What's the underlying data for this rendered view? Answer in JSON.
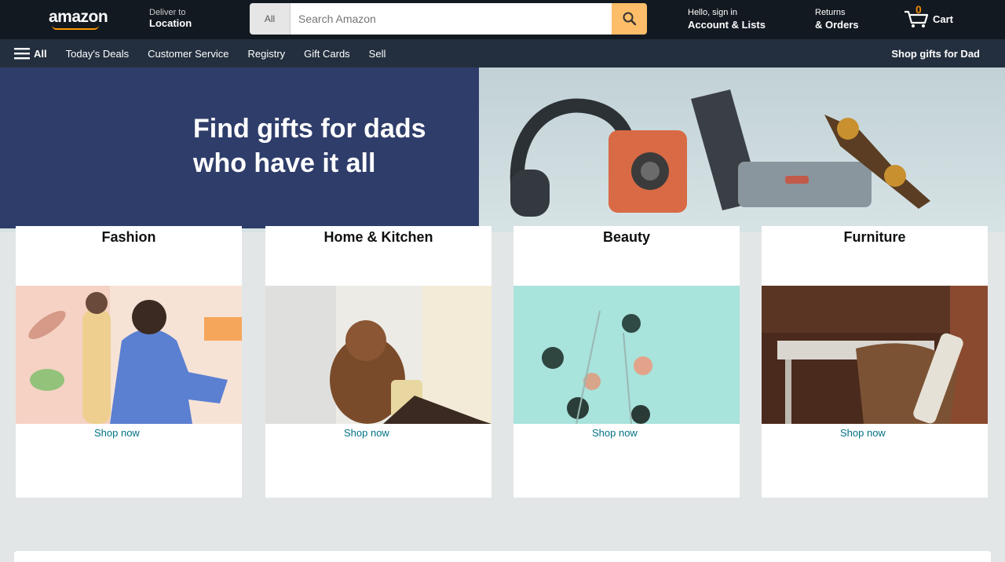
{
  "topnav": {
    "logo": "amazon",
    "deliver_line1": "Deliver to",
    "deliver_line2": "Location",
    "search_category": "All",
    "search_value": "",
    "search_placeholder": "Search Amazon",
    "account_line1": "Hello, sign in",
    "account_line2": "Account & Lists",
    "returns_line1": "Returns",
    "returns_line2": "& Orders",
    "cart_label": "Cart",
    "cart_count": "0"
  },
  "subnav": {
    "all_label": "All",
    "items": [
      "Today's Deals",
      "Customer Service",
      "Registry",
      "Gift Cards",
      "Sell"
    ],
    "promo": "Shop gifts for Dad"
  },
  "hero": {
    "title": "Find gifts for dads who have it all"
  },
  "cards": [
    {
      "title": "Fashion",
      "link": "Shop now"
    },
    {
      "title": "Home & Kitchen",
      "link": "Shop now"
    },
    {
      "title": "Beauty",
      "link": "Shop now"
    },
    {
      "title": "Furniture",
      "link": "Shop now"
    }
  ],
  "colors": {
    "nav_dark": "#131921",
    "subnav": "#232f3e",
    "accent": "#febd69",
    "hero_blue": "#2f3d6a"
  }
}
